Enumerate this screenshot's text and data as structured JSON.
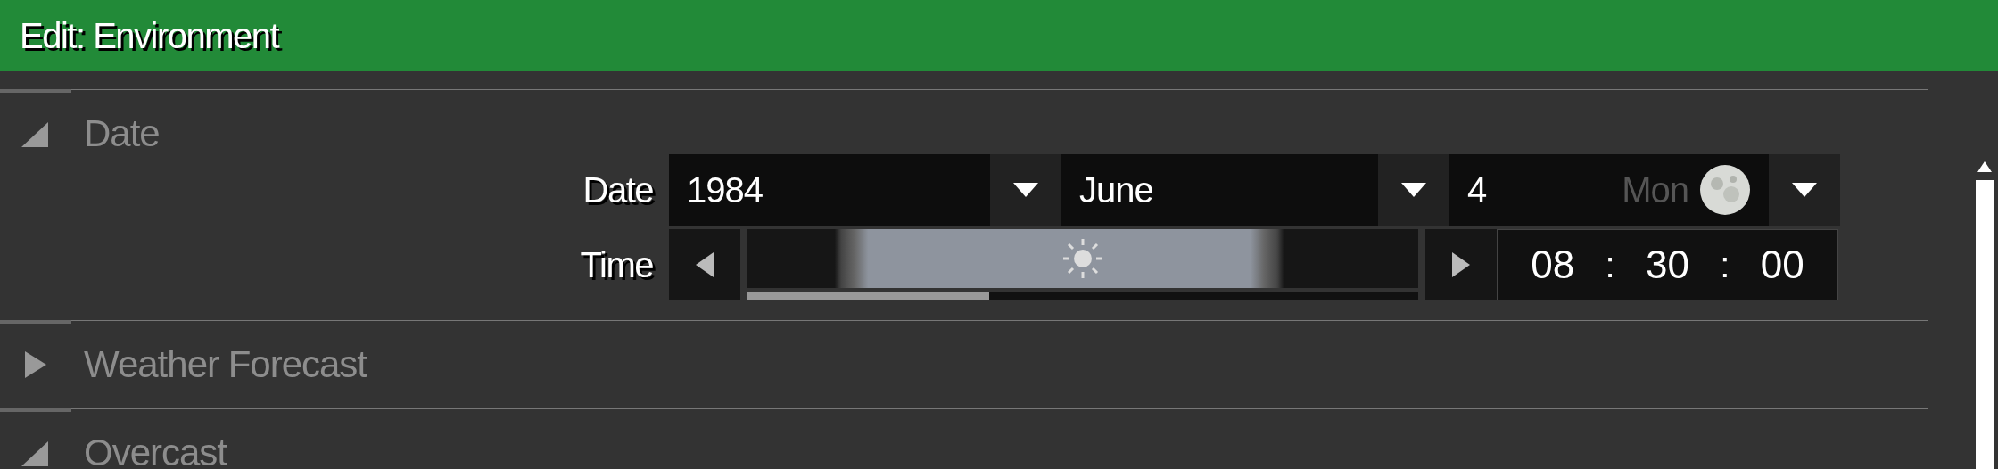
{
  "window": {
    "title": "Edit: Environment"
  },
  "sections": [
    {
      "title": "Date",
      "expanded": true,
      "date": {
        "label": "Date",
        "year": "1984",
        "month": "June",
        "day": "4",
        "weekday": "Mon"
      },
      "time": {
        "label": "Time",
        "level": 0.36,
        "hours": "08",
        "minutes": "30",
        "seconds": "00",
        "separator_1": ":",
        "separator_2": ":"
      }
    },
    {
      "title": "Weather Forecast",
      "expanded": false
    },
    {
      "title": "Overcast",
      "expanded": true
    }
  ]
}
